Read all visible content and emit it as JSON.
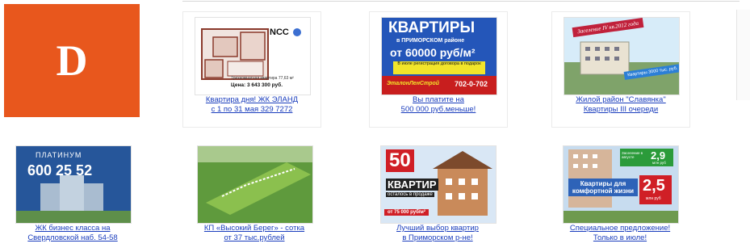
{
  "logo": {
    "letter": "D",
    "color": "#e8571d"
  },
  "ads": [
    {
      "caption": [
        "Квартира дня! ЖК ЭЛАНД",
        "с 1 по 31 мая 329 7272"
      ],
      "thumb": {
        "brand": "NCC",
        "plan_text": "Трехкомнатная квартира 77,63 м²",
        "price": "Цена: 3 643 300 руб."
      }
    },
    {
      "caption": [
        "Вы платите на",
        "500 000 руб.меньше!"
      ],
      "thumb": {
        "title": "КВАРТИРЫ",
        "subtitle": "в ПРИМОРСКОМ районе",
        "price": "от 60000 руб/м²",
        "note": "В июле регистрация договора в подарок",
        "company": "ЭталонЛенСтрой",
        "phone": "702-0-702"
      }
    },
    {
      "caption": [
        "Жилой район \"Славянка\"",
        "Квартиры III очереди"
      ],
      "thumb": {
        "banner": "Заселение IV кв.2012 года",
        "price_tag": "Квартиры 3000 тыс. руб."
      }
    },
    {
      "caption": [
        "ЖК бизнес класса на",
        "Свердловской наб. 54-58"
      ],
      "thumb": {
        "brand": "ПЛАТИНУМ",
        "phone": "600 25 52"
      }
    },
    {
      "caption": [
        "КП «Высокий Берег» - сотка",
        "от 37 тыс.рублей"
      ],
      "thumb": {}
    },
    {
      "caption": [
        "Лучший выбор квартир",
        "в Приморском р-не!"
      ],
      "thumb": {
        "number": "50",
        "title": "КВАРТИР",
        "subtitle": "осталось в продаже",
        "price": "от 75 000 руб/м²"
      }
    },
    {
      "caption": [
        "Специальное предложение!",
        "Только в июле!"
      ],
      "thumb": {
        "badge_top_label": "Заселение в августе",
        "badge_top_value": "2,9",
        "badge_top_unit": "млн руб",
        "headline": "Квартиры для комфортной жизни",
        "badge_value": "2,5",
        "badge_unit": "млн руб"
      }
    }
  ]
}
